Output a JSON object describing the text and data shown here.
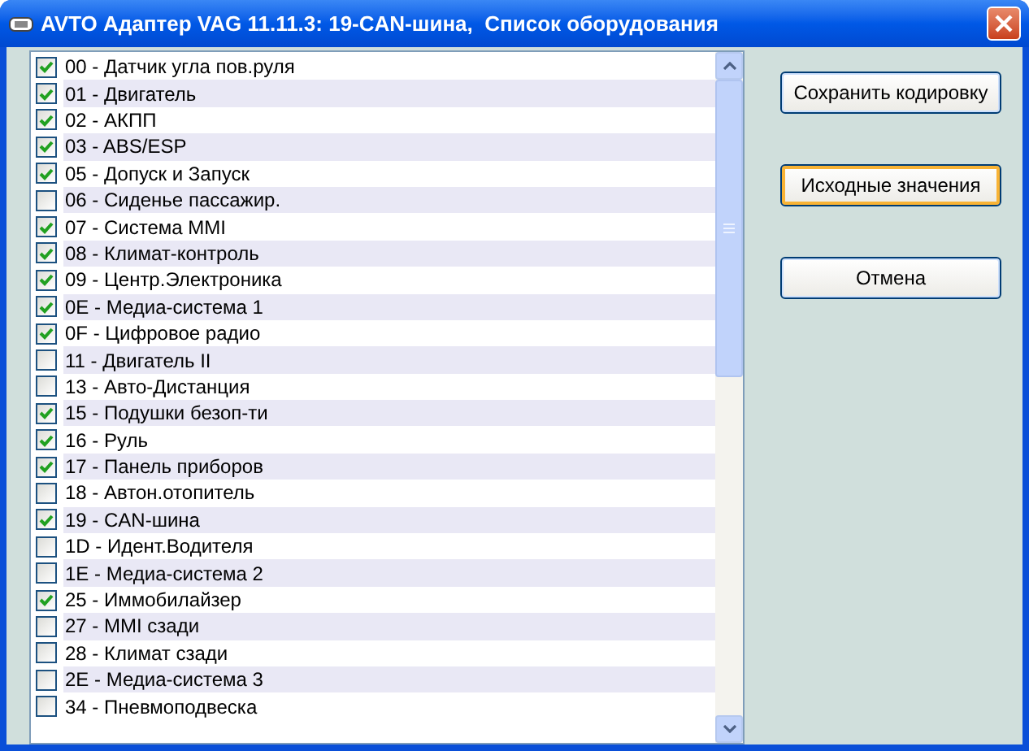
{
  "window": {
    "title": "AVTO Адаптер VAG 11.11.3: 19-CAN-шина,  Список оборудования"
  },
  "list": [
    {
      "label": "00 - Датчик угла пов.руля",
      "checked": true
    },
    {
      "label": "01 - Двигатель",
      "checked": true
    },
    {
      "label": "02 - АКПП",
      "checked": true
    },
    {
      "label": "03 - ABS/ESP",
      "checked": true
    },
    {
      "label": "05 - Допуск и Запуск",
      "checked": true
    },
    {
      "label": "06 - Сиденье пассажир.",
      "checked": false
    },
    {
      "label": "07 - Система MMI",
      "checked": true
    },
    {
      "label": "08 - Климат-контроль",
      "checked": true
    },
    {
      "label": "09 - Центр.Электроника",
      "checked": true
    },
    {
      "label": "0E - Медиа-система 1",
      "checked": true
    },
    {
      "label": "0F - Цифровое радио",
      "checked": true
    },
    {
      "label": "11 - Двигатель II",
      "checked": false
    },
    {
      "label": "13 - Авто-Дистанция",
      "checked": false
    },
    {
      "label": "15 - Подушки безоп-ти",
      "checked": true
    },
    {
      "label": "16 - Руль",
      "checked": true
    },
    {
      "label": "17 - Панель приборов",
      "checked": true
    },
    {
      "label": "18 - Автон.отопитель",
      "checked": false
    },
    {
      "label": "19 - CAN-шина",
      "checked": true
    },
    {
      "label": "1D - Идент.Водителя",
      "checked": false
    },
    {
      "label": "1E - Медиа-система 2",
      "checked": false
    },
    {
      "label": "25 - Иммобилайзер",
      "checked": true
    },
    {
      "label": "27 - MMI сзади",
      "checked": false
    },
    {
      "label": "28 - Климат сзади",
      "checked": false
    },
    {
      "label": "2E - Медиа-система 3",
      "checked": false
    },
    {
      "label": "34 - Пневмоподвеска",
      "checked": false
    }
  ],
  "buttons": [
    {
      "label": "Сохранить кодировку",
      "focused": false
    },
    {
      "label": "Исходные значения",
      "focused": true
    },
    {
      "label": "Отмена",
      "focused": false
    }
  ]
}
